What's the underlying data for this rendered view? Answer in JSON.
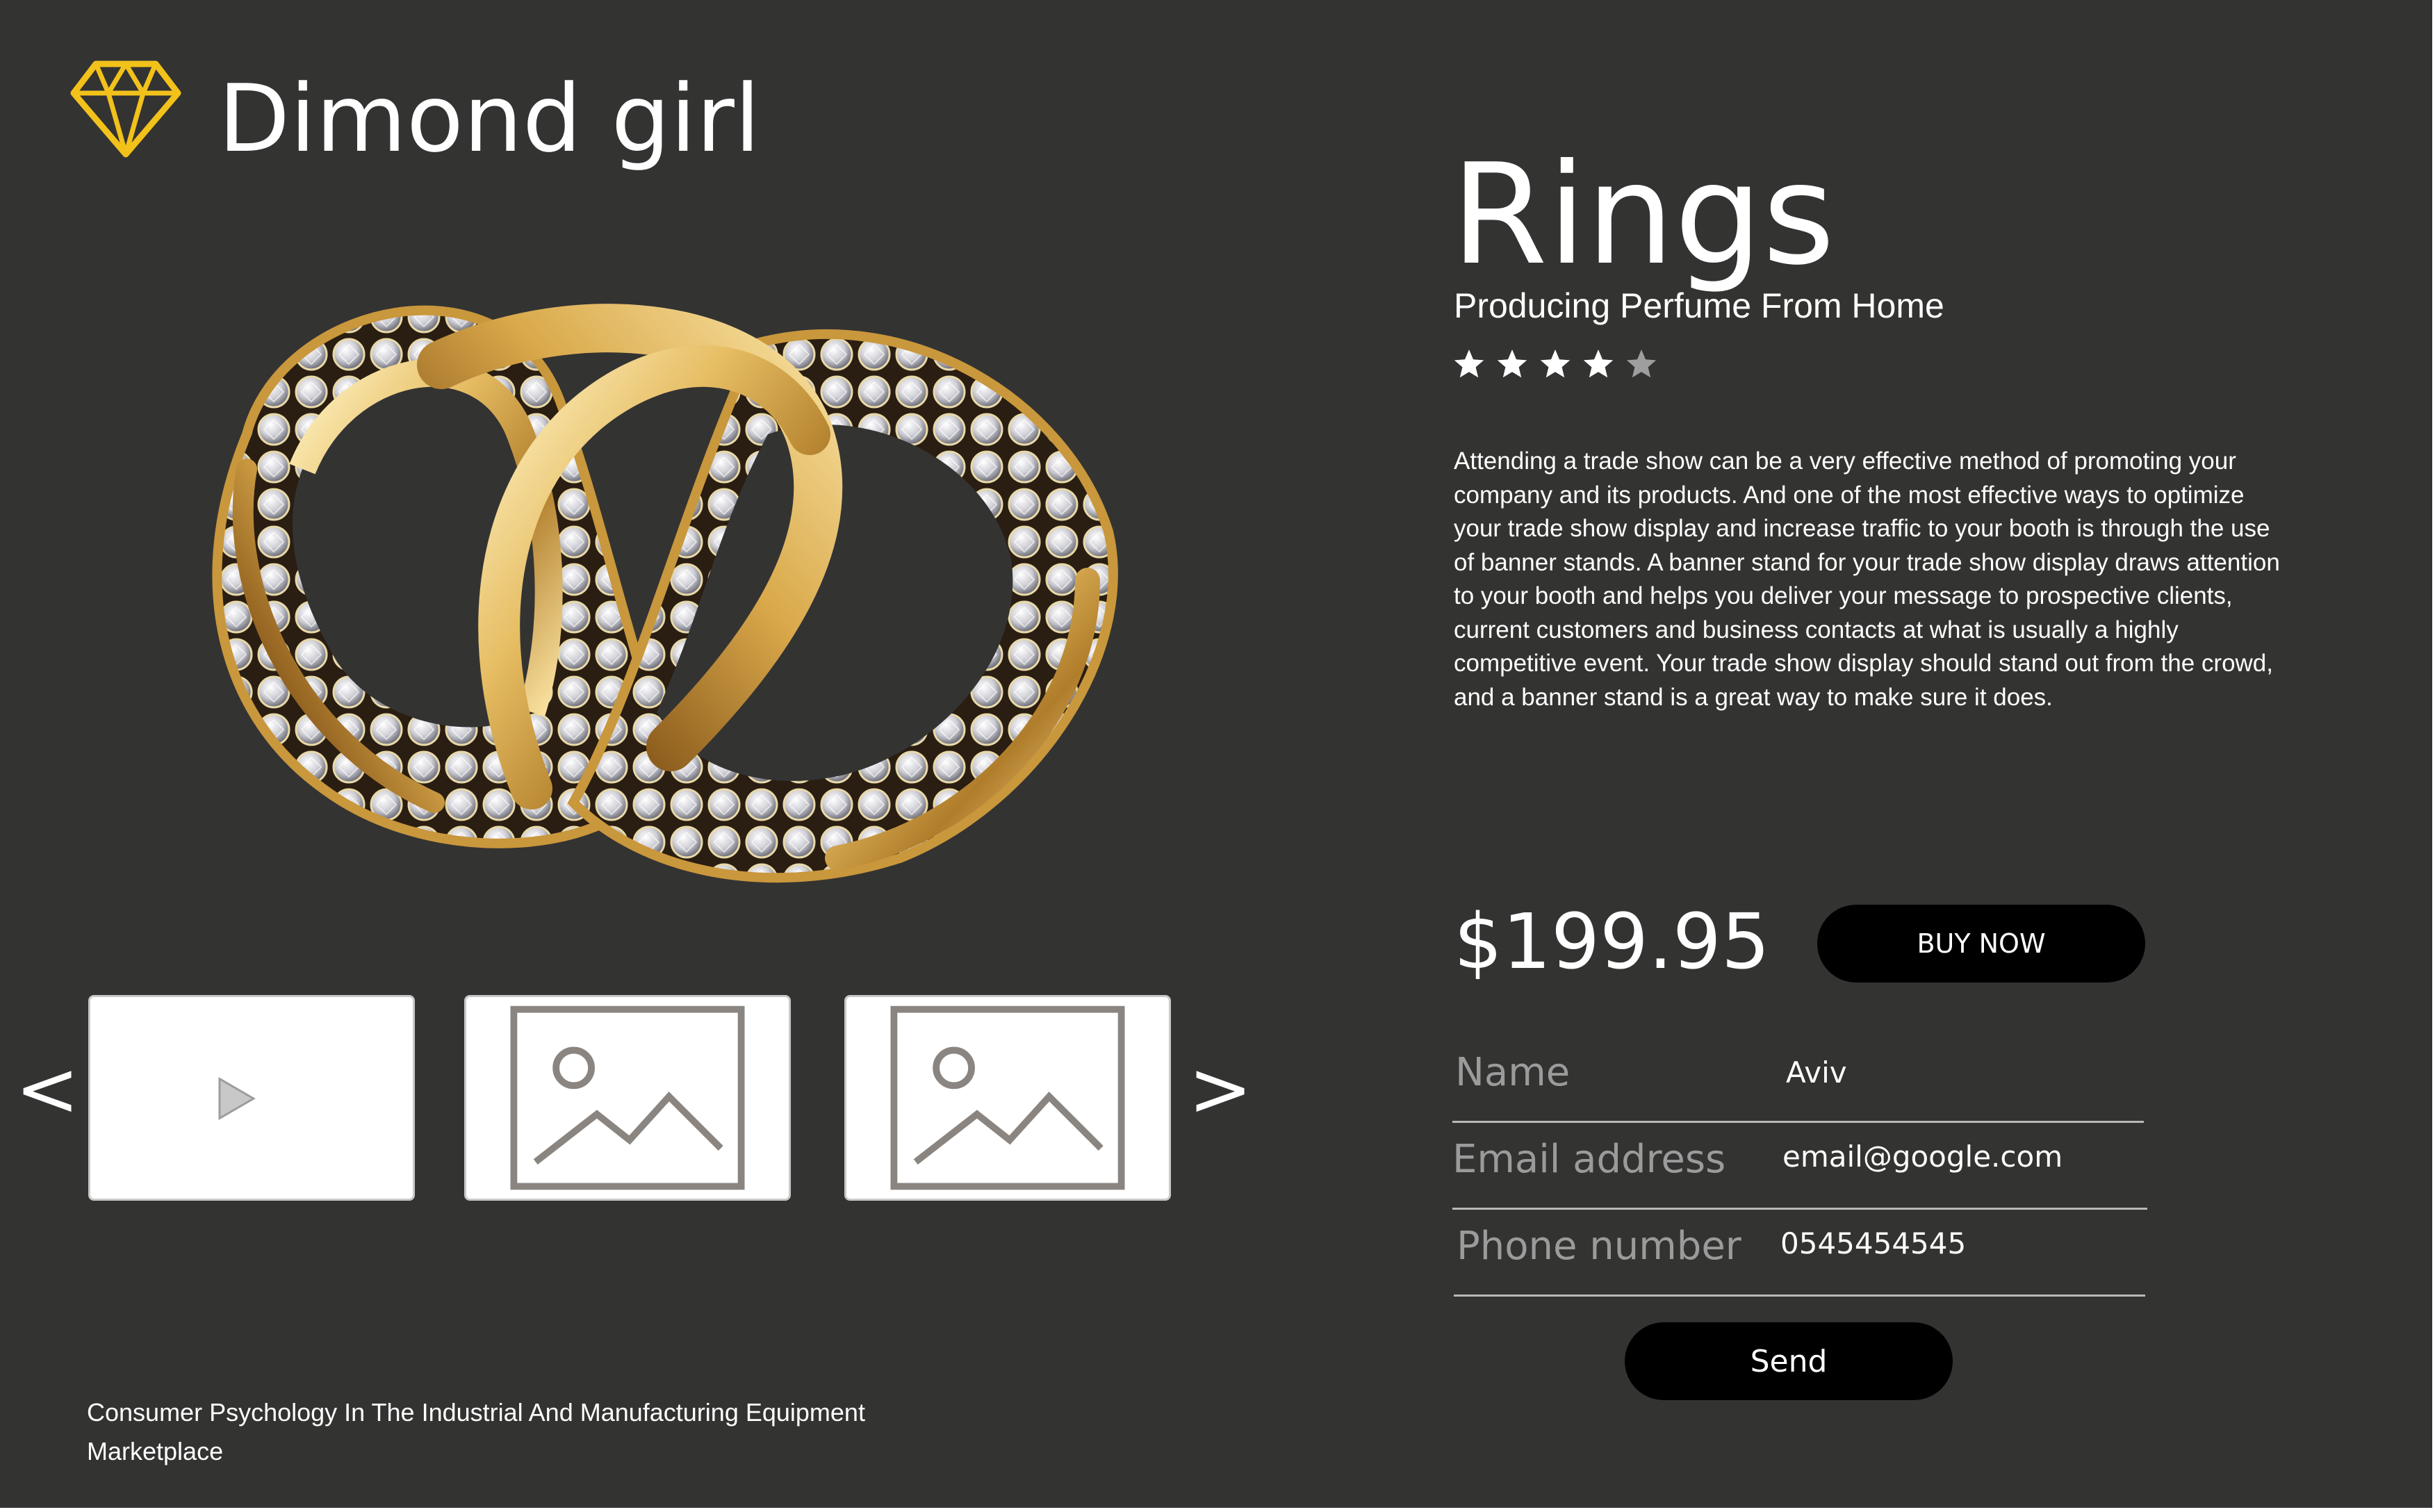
{
  "brand": {
    "name": "Dimond girl",
    "logo_icon": "diamond-outline-icon",
    "logo_color": "#f2c21b"
  },
  "hero_image": {
    "icon": "gold-diamond-rings-illustration"
  },
  "carousel": {
    "prev_label": "<",
    "next_label": ">",
    "thumbnails": [
      {
        "type": "video",
        "icon": "play-icon"
      },
      {
        "type": "image",
        "icon": "image-placeholder-icon"
      },
      {
        "type": "image",
        "icon": "image-placeholder-icon"
      }
    ]
  },
  "footer": {
    "text": "Consumer Psychology In The Industrial And Manufacturing Equipment Marketplace"
  },
  "product": {
    "title": "Rings",
    "subtitle": "Producing Perfume From Home",
    "rating": {
      "value": 4,
      "max": 5,
      "filled_color": "#ffffff",
      "empty_color": "#9e9e9e"
    },
    "description": "Attending a trade show can be a very effective method of promoting your company and its products. And one of the most effective ways to optimize your trade show display and increase traffic to your booth is through the use of banner stands. A banner stand for your trade show display draws attention to your booth and helps you deliver your message to prospective clients, current customers and business contacts at what is usually a highly competitive event. Your trade show display should stand out from the crowd, and a banner stand is a great way to make sure it does.",
    "price": "$199.95",
    "buy_label": "BUY NOW"
  },
  "form": {
    "name_label": "Name",
    "name_value": "Aviv",
    "email_label": "Email address",
    "email_value": "email@google.com",
    "phone_label": "Phone number",
    "phone_value": "0545454545",
    "send_label": "Send"
  },
  "colors": {
    "background": "#333332",
    "button": "#000000",
    "text": "#ffffff",
    "muted_text": "#9b9b9b",
    "gold": "#d9a93c"
  }
}
